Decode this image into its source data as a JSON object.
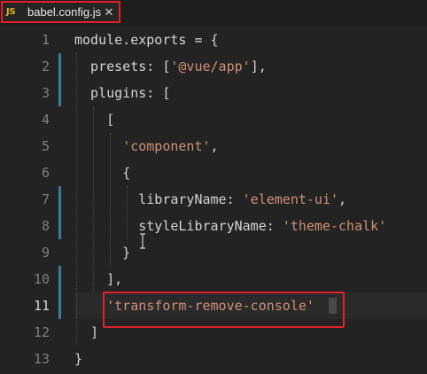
{
  "tab": {
    "icon_text": "JS",
    "filename": "babel.config.js",
    "close_glyph": "✕"
  },
  "editor": {
    "lines": [
      {
        "n": "1",
        "tokens": [
          {
            "t": "plain",
            "v": "module.exports = {"
          }
        ]
      },
      {
        "n": "2",
        "tokens": [
          {
            "t": "plain",
            "v": "  presets: ["
          },
          {
            "t": "str",
            "v": "'@vue/app'"
          },
          {
            "t": "plain",
            "v": "],"
          }
        ]
      },
      {
        "n": "3",
        "tokens": [
          {
            "t": "plain",
            "v": "  plugins: ["
          }
        ]
      },
      {
        "n": "4",
        "tokens": [
          {
            "t": "plain",
            "v": "    ["
          }
        ]
      },
      {
        "n": "5",
        "tokens": [
          {
            "t": "plain",
            "v": "      "
          },
          {
            "t": "str",
            "v": "'component'"
          },
          {
            "t": "plain",
            "v": ","
          }
        ]
      },
      {
        "n": "6",
        "tokens": [
          {
            "t": "plain",
            "v": "      {"
          }
        ]
      },
      {
        "n": "7",
        "tokens": [
          {
            "t": "plain",
            "v": "        libraryName: "
          },
          {
            "t": "str",
            "v": "'element-ui'"
          },
          {
            "t": "plain",
            "v": ","
          }
        ]
      },
      {
        "n": "8",
        "tokens": [
          {
            "t": "plain",
            "v": "        styleLibraryName: "
          },
          {
            "t": "str",
            "v": "'theme-chalk'"
          }
        ]
      },
      {
        "n": "9",
        "tokens": [
          {
            "t": "plain",
            "v": "      }"
          }
        ]
      },
      {
        "n": "10",
        "tokens": [
          {
            "t": "plain",
            "v": "    ],"
          }
        ]
      },
      {
        "n": "11",
        "tokens": [
          {
            "t": "plain",
            "v": "    "
          },
          {
            "t": "str",
            "v": "'transform-remove-console'"
          }
        ]
      },
      {
        "n": "12",
        "tokens": [
          {
            "t": "plain",
            "v": "  ]"
          }
        ]
      },
      {
        "n": "13",
        "tokens": [
          {
            "t": "plain",
            "v": "}"
          }
        ]
      }
    ],
    "active_line": "11"
  },
  "colors": {
    "string": "#ce9178",
    "text": "#d4d4d4",
    "line_number": "#7f7f7f",
    "annotation_red": "#e0202a",
    "git_modified": "#3c7a96",
    "js_icon": "#e6b422"
  }
}
